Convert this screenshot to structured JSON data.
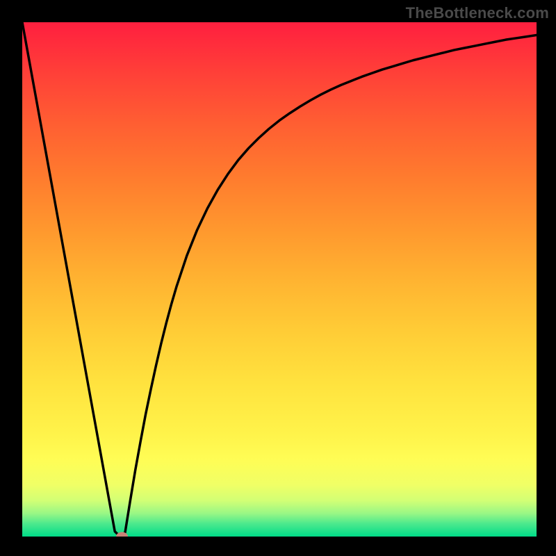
{
  "chart_data": {
    "type": "line",
    "title": "",
    "xlabel": "",
    "ylabel": "",
    "watermark": "TheBottleneck.com",
    "xlim": [
      0,
      100
    ],
    "ylim": [
      0,
      100
    ],
    "x": [
      0,
      1,
      2,
      3,
      4,
      5,
      6,
      7,
      8,
      9,
      10,
      11,
      12,
      13,
      14,
      15,
      16,
      17,
      18,
      19,
      20,
      21,
      22,
      23,
      24,
      25,
      26,
      27,
      28,
      29,
      30,
      32,
      34,
      36,
      38,
      40,
      42,
      44,
      46,
      48,
      50,
      52,
      54,
      56,
      58,
      60,
      62,
      64,
      66,
      68,
      70,
      72,
      74,
      76,
      78,
      80,
      82,
      84,
      86,
      88,
      90,
      92,
      94,
      96,
      98,
      100
    ],
    "values": [
      100,
      94.5,
      89,
      83.5,
      78,
      72.5,
      67,
      61.5,
      56,
      50.5,
      45,
      39.5,
      34,
      28.5,
      23,
      17.5,
      12,
      6.5,
      1,
      0,
      0.8,
      7,
      13,
      18.5,
      23.8,
      28.6,
      33.2,
      37.5,
      41.5,
      45.2,
      48.6,
      54.6,
      59.6,
      63.8,
      67.4,
      70.5,
      73.2,
      75.5,
      77.5,
      79.3,
      80.9,
      82.3,
      83.6,
      84.8,
      85.9,
      86.9,
      87.8,
      88.6,
      89.4,
      90.1,
      90.8,
      91.4,
      92,
      92.6,
      93.1,
      93.6,
      94.1,
      94.6,
      95,
      95.4,
      95.8,
      96.2,
      96.6,
      96.9,
      97.2,
      97.5
    ],
    "optimal_point": {
      "x": 19.4,
      "y": 0
    }
  },
  "gradient_stops": [
    {
      "offset": 0.0,
      "color": "#ff1f3f"
    },
    {
      "offset": 0.1,
      "color": "#ff4038"
    },
    {
      "offset": 0.2,
      "color": "#ff5f32"
    },
    {
      "offset": 0.3,
      "color": "#ff7b2e"
    },
    {
      "offset": 0.4,
      "color": "#ff972e"
    },
    {
      "offset": 0.5,
      "color": "#ffb331"
    },
    {
      "offset": 0.6,
      "color": "#ffcc36"
    },
    {
      "offset": 0.7,
      "color": "#ffe23e"
    },
    {
      "offset": 0.8,
      "color": "#fff34a"
    },
    {
      "offset": 0.85,
      "color": "#fffd55"
    },
    {
      "offset": 0.9,
      "color": "#f0ff66"
    },
    {
      "offset": 0.93,
      "color": "#d2ff75"
    },
    {
      "offset": 0.955,
      "color": "#99f785"
    },
    {
      "offset": 0.975,
      "color": "#4ce98d"
    },
    {
      "offset": 1.0,
      "color": "#00dc88"
    }
  ],
  "marker_color": "#c98176",
  "curve_color": "#000000"
}
